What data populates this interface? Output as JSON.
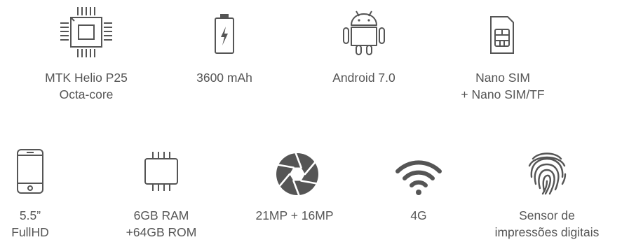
{
  "colors": {
    "icon": "#555555",
    "text": "#555555",
    "background": "#ffffff"
  },
  "features": [
    {
      "icon": "cpu-chip-icon",
      "lines": [
        "MTK Helio P25",
        "Octa-core"
      ]
    },
    {
      "icon": "battery-icon",
      "lines": [
        "3600 mAh"
      ]
    },
    {
      "icon": "android-icon",
      "lines": [
        "Android 7.0"
      ]
    },
    {
      "icon": "sim-card-icon",
      "lines": [
        "Nano SIM",
        "+ Nano SIM/TF"
      ]
    },
    {
      "icon": "smartphone-icon",
      "lines": [
        "5.5”",
        "FullHD"
      ]
    },
    {
      "icon": "memory-chip-icon",
      "lines": [
        "6GB RAM",
        "+64GB ROM"
      ]
    },
    {
      "icon": "camera-aperture-icon",
      "lines": [
        "21MP + 16MP"
      ]
    },
    {
      "icon": "wifi-signal-icon",
      "lines": [
        "4G"
      ]
    },
    {
      "icon": "fingerprint-icon",
      "lines": [
        "Sensor de",
        "impressões digitais"
      ]
    }
  ]
}
